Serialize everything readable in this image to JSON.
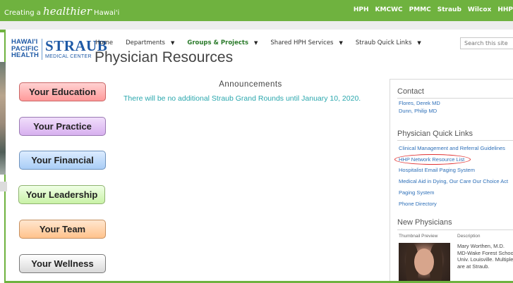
{
  "topbar": {
    "tagline_prefix": "Creating a",
    "tagline_script": "healthier",
    "tagline_suffix": "Hawai'i",
    "links": [
      "HPH",
      "KMCWC",
      "PMMC",
      "Straub",
      "Wilcox",
      "HHP"
    ]
  },
  "logo": {
    "hph_line1": "HAWAI'I",
    "hph_line2": "PACIFIC",
    "hph_line3": "HEALTH",
    "straub": "STRAUB",
    "medical_center": "MEDICAL CENTER"
  },
  "nav": {
    "items": [
      {
        "label": "Home",
        "dropdown": false
      },
      {
        "label": "Departments",
        "dropdown": true
      },
      {
        "label": "Groups & Projects",
        "dropdown": true
      },
      {
        "label": "Shared HPH Services",
        "dropdown": true
      },
      {
        "label": "Straub Quick Links",
        "dropdown": true
      }
    ]
  },
  "search": {
    "placeholder": "Search this site"
  },
  "page_title": "Physician Resources",
  "buttons": {
    "education": "Your Education",
    "practice": "Your Practice",
    "financial": "Your Financial",
    "leadership": "Your Leadership",
    "team": "Your Team",
    "wellness": "Your Wellness"
  },
  "announcements": {
    "title": "Announcements",
    "body": "There will be no additional Straub Grand Rounds until January 10, 2020."
  },
  "contact": {
    "title": "Contact",
    "people": [
      "Flores, Derek MD",
      "Dunn, Philip MD"
    ]
  },
  "quick_links": {
    "title": "Physician Quick Links",
    "items": [
      "Clinical Management and Referral Guidelines",
      "HHP Network Resource List",
      "Hospitalist Email Paging System",
      "Medical Aid in Dying, Our Care Our Choice Act",
      "Paging System",
      "Phone Directory"
    ]
  },
  "new_physicians": {
    "title": "New Physicians",
    "col_thumb": "Thumbnail Preview",
    "col_desc": "Description",
    "entry": {
      "name": "Mary Worthen, M.D.",
      "line2": "MD-Wake Forest School",
      "line3": "Univ. Louisville. Multiple",
      "line4": "are at Straub."
    }
  },
  "colors": {
    "brand_green": "#6fb23f",
    "link_blue": "#2d6fb8",
    "announcement_teal": "#2aa7ad",
    "highlight_red": "#e03030"
  }
}
